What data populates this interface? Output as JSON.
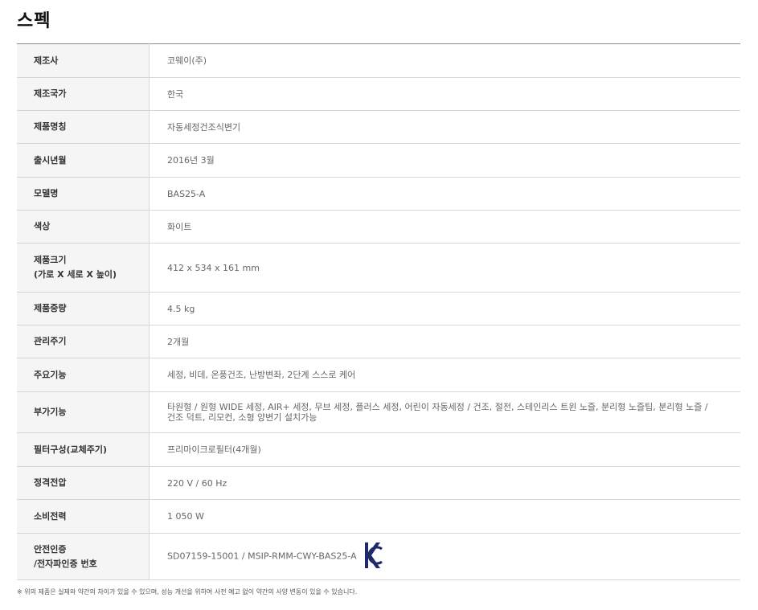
{
  "title": "스펙",
  "rows": [
    {
      "label": "제조사",
      "value": "코웨이(주)"
    },
    {
      "label": "제조국가",
      "value": "한국"
    },
    {
      "label": "제품명칭",
      "value": "자동세정건조식변기"
    },
    {
      "label": "출시년월",
      "value": "2016년 3월"
    },
    {
      "label": "모델명",
      "value": "BAS25-A"
    },
    {
      "label": "색상",
      "value": "화이트"
    },
    {
      "label": "제품크기\n(가로 X 세로 X 높이)",
      "value": "412 x 534 x 161 mm"
    },
    {
      "label": "제품중량",
      "value": "4.5 kg"
    },
    {
      "label": "관리주기",
      "value": "2개월"
    },
    {
      "label": "주요기능",
      "value": "세정, 비데, 온풍건조, 난방변좌, 2단계 스스로 케어"
    },
    {
      "label": "부가기능",
      "value": "타원형 / 원형 WIDE 세정, AIR+ 세정, 무브 세정, 플러스 세정, 어린이 자동세정 / 건조, 절전, 스테인리스 트윈 노즐, 분리형 노즐팁, 분리형 노즐 /\n건조 덕트, 리모컨, 소형 양변기 설치가능"
    },
    {
      "label": "필터구성(교체주기)",
      "value": "프리마이크로필터(4개월)"
    },
    {
      "label": "정격전압",
      "value": "220 V / 60 Hz"
    },
    {
      "label": "소비전력",
      "value": "1 050 W"
    },
    {
      "label": "안전인증\n/전자파인증 번호",
      "value": "SD07159-15001 / MSIP-RMM-CWY-BAS25-A",
      "badge": "KC"
    }
  ],
  "footnote": "※ 위의 제품은 실제와 약간의 차이가 있을 수 있으며, 성능 개선을 위하여 사전 예고 없이 약간의 사양 변동이 있을 수 있습니다.",
  "colors": {
    "header_bg": "#f5f5f5",
    "border": "#d6d6d6",
    "kc_mark": "#1f2a6b"
  }
}
